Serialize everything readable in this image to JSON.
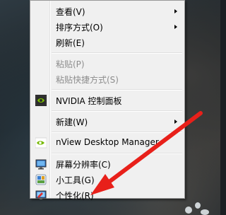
{
  "menu": {
    "items": [
      {
        "label": "查看(V)"
      },
      {
        "label": "排序方式(O)"
      },
      {
        "label": "刷新(E)"
      },
      {
        "label": "粘贴(P)"
      },
      {
        "label": "粘贴快捷方式(S)"
      },
      {
        "label": "NVIDIA 控制面板"
      },
      {
        "label": "新建(W)"
      },
      {
        "label": "nView Desktop Manager"
      },
      {
        "label": "屏幕分辨率(C)"
      },
      {
        "label": "小工具(G)"
      },
      {
        "label": "个性化(R)"
      }
    ]
  },
  "colors": {
    "menu_background": "#f0f0f0",
    "disabled_text": "#8d8d8d",
    "annotation_arrow": "#e8201a",
    "nvidia_green": "#76b900"
  },
  "icons": {
    "nvidia": "nvidia-logo-icon",
    "nview": "nview-logo-icon",
    "screen_resolution": "monitor-icon",
    "gadgets": "gadgets-icon",
    "personalize": "personalize-icon",
    "annotation": "red-arrow-icon"
  }
}
